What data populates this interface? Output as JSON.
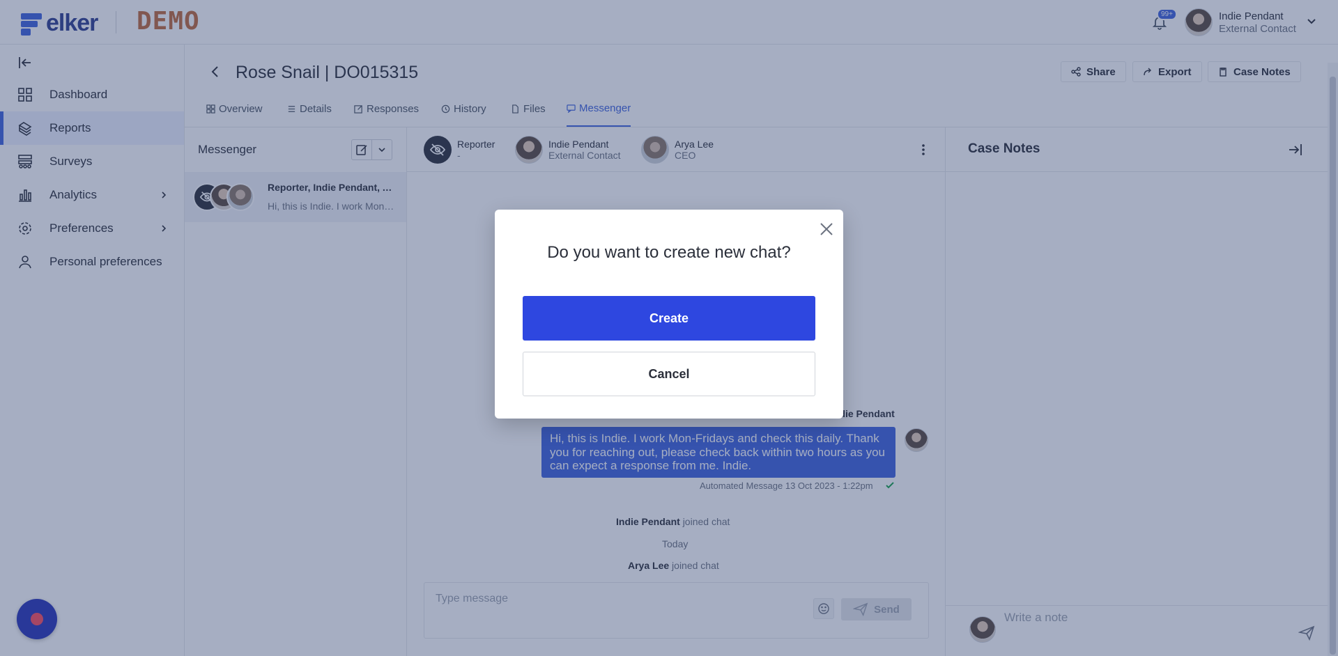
{
  "header": {
    "logo_text": "elker",
    "env_label": "DEMO",
    "notification_badge": "99+",
    "user": {
      "name": "Indie Pendant",
      "role": "External Contact"
    }
  },
  "sidebar": {
    "items": [
      {
        "label": "Dashboard",
        "icon": "dashboard-icon",
        "active": false,
        "has_children": false
      },
      {
        "label": "Reports",
        "icon": "reports-icon",
        "active": true,
        "has_children": false
      },
      {
        "label": "Surveys",
        "icon": "surveys-icon",
        "active": false,
        "has_children": false
      },
      {
        "label": "Analytics",
        "icon": "analytics-icon",
        "active": false,
        "has_children": true
      },
      {
        "label": "Preferences",
        "icon": "preferences-icon",
        "active": false,
        "has_children": true
      },
      {
        "label": "Personal preferences",
        "icon": "user-icon",
        "active": false,
        "has_children": false
      }
    ]
  },
  "page": {
    "title": "Rose Snail | DO015315",
    "actions": {
      "share": "Share",
      "export": "Export",
      "case_notes": "Case Notes"
    },
    "tabs": [
      {
        "label": "Overview",
        "active": false
      },
      {
        "label": "Details",
        "active": false
      },
      {
        "label": "Responses",
        "active": false
      },
      {
        "label": "History",
        "active": false
      },
      {
        "label": "Files",
        "active": false
      },
      {
        "label": "Messenger",
        "active": true
      }
    ]
  },
  "messenger": {
    "title": "Messenger",
    "conversation": {
      "participants_label": "Reporter, Indie Pendant, Arya Lee",
      "preview": "Hi, this is Indie. I work Mon-Fridays and check this daily."
    }
  },
  "chat": {
    "participants": [
      {
        "name": "Reporter",
        "role": "-"
      },
      {
        "name": "Indie Pendant",
        "role": "External Contact"
      },
      {
        "name": "Arya Lee",
        "role": "CEO"
      }
    ],
    "message": {
      "sender": "Indie Pendant",
      "text": "Hi, this is Indie. I work Mon-Fridays and check this daily. Thank you for reaching out, please check back within two hours as you can expect a response from me. Indie.",
      "meta": "Automated Message 13 Oct 2023 - 1:22pm"
    },
    "events": {
      "event1_name": "Indie Pendant",
      "event1_text": "joined chat",
      "divider": "Today",
      "event2_name": "Arya Lee",
      "event2_text": "joined chat"
    },
    "composer": {
      "placeholder": "Type message",
      "send_label": "Send"
    }
  },
  "case_notes": {
    "title": "Case Notes",
    "placeholder": "Write a note"
  },
  "modal": {
    "title": "Do you want to create new chat?",
    "create_label": "Create",
    "cancel_label": "Cancel"
  },
  "colors": {
    "accent": "#3e63dd",
    "primary_button": "#2e47e0",
    "overlay": "#2c3e6e",
    "demo_label": "#c06a3c"
  }
}
